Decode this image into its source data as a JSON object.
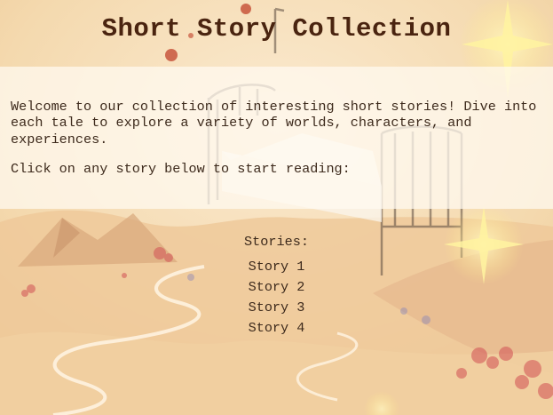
{
  "page": {
    "title": "Short Story Collection"
  },
  "intro": {
    "welcome": "Welcome to our collection of interesting short stories! Dive into each tale to explore a variety of worlds, characters, and experiences.",
    "call_to_action": "Click on any story below to start reading:"
  },
  "stories": {
    "heading": "Stories:",
    "items": [
      {
        "label": "Story 1"
      },
      {
        "label": "Story 2"
      },
      {
        "label": "Story 3"
      },
      {
        "label": "Story 4"
      }
    ]
  }
}
